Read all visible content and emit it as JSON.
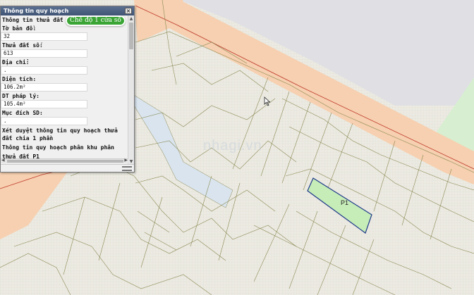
{
  "panel": {
    "title": "Thông tin quy hoạch",
    "close_glyph": "×",
    "header_row": "Thông tin thửa đất [↗",
    "fields": [
      {
        "label": "Tờ bản đồ:",
        "value": "32"
      },
      {
        "label": "Thửa đất số:",
        "value": "613"
      },
      {
        "label": "Địa chỉ:",
        "value": "."
      },
      {
        "label": "Diện tích:",
        "value": "106.2m²"
      },
      {
        "label": "DT pháp lý:",
        "value": "105.4m²"
      },
      {
        "label": "Mục đích SD:",
        "value": "."
      }
    ],
    "links": [
      "Xét duyệt thông tin quy hoạch thửa đất chia 1 phần",
      "Thông tin quy hoạch phân khu phân",
      "thửa đất P1"
    ]
  },
  "mode_button": {
    "label": "Chế độ 1 cửa sổ"
  },
  "map": {
    "plot_label": "P1",
    "watermark": "nhagi.vn",
    "colors": {
      "road": "#f6d0b0",
      "background": "#ecebe3",
      "parcel_line": "#8c8a55",
      "highlight_fill": "#c6ecb8",
      "highlight_stroke": "#1f3a8a",
      "block": "#dfdfe4",
      "green": "#d7efd0",
      "street": "#d9e4ee",
      "red_line": "#c0392b"
    }
  }
}
